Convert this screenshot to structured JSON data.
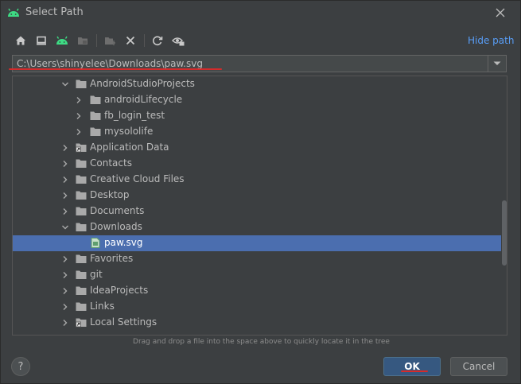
{
  "window": {
    "title": "Select Path",
    "icon": "android-icon"
  },
  "toolbar": {
    "buttons": [
      "home-icon",
      "desktop-icon",
      "android-project-icon",
      "module-icon",
      "new-folder-icon",
      "delete-icon",
      "refresh-icon",
      "show-hidden-icon"
    ],
    "hide_path_label": "Hide path"
  },
  "path": {
    "value": "C:\\Users\\shinyelee\\Downloads\\paw.svg"
  },
  "tree": {
    "items": [
      {
        "label": "AndroidStudioProjects",
        "expanded": true,
        "type": "folder"
      },
      {
        "label": "androidLifecycle",
        "expanded": false,
        "type": "folder"
      },
      {
        "label": "fb_login_test",
        "expanded": false,
        "type": "folder"
      },
      {
        "label": "mysololife",
        "expanded": false,
        "type": "folder"
      },
      {
        "label": "Application Data",
        "expanded": false,
        "type": "folder-link"
      },
      {
        "label": "Contacts",
        "expanded": false,
        "type": "folder"
      },
      {
        "label": "Creative Cloud Files",
        "expanded": false,
        "type": "folder"
      },
      {
        "label": "Desktop",
        "expanded": false,
        "type": "folder"
      },
      {
        "label": "Documents",
        "expanded": false,
        "type": "folder"
      },
      {
        "label": "Downloads",
        "expanded": true,
        "type": "folder"
      },
      {
        "label": "paw.svg",
        "expanded": null,
        "type": "file",
        "selected": true
      },
      {
        "label": "Favorites",
        "expanded": false,
        "type": "folder"
      },
      {
        "label": "git",
        "expanded": false,
        "type": "folder"
      },
      {
        "label": "IdeaProjects",
        "expanded": false,
        "type": "folder"
      },
      {
        "label": "Links",
        "expanded": false,
        "type": "folder"
      },
      {
        "label": "Local Settings",
        "expanded": false,
        "type": "folder-link"
      }
    ]
  },
  "hint": "Drag and drop a file into the space above to quickly locate it in the tree",
  "buttons": {
    "help": "?",
    "ok": "OK",
    "cancel": "Cancel"
  },
  "colors": {
    "accent": "#589df6",
    "selection": "#4b6eaf",
    "ok_button": "#365880",
    "annotation_underline": "#d42b2b",
    "android_green": "#3ddc84"
  }
}
